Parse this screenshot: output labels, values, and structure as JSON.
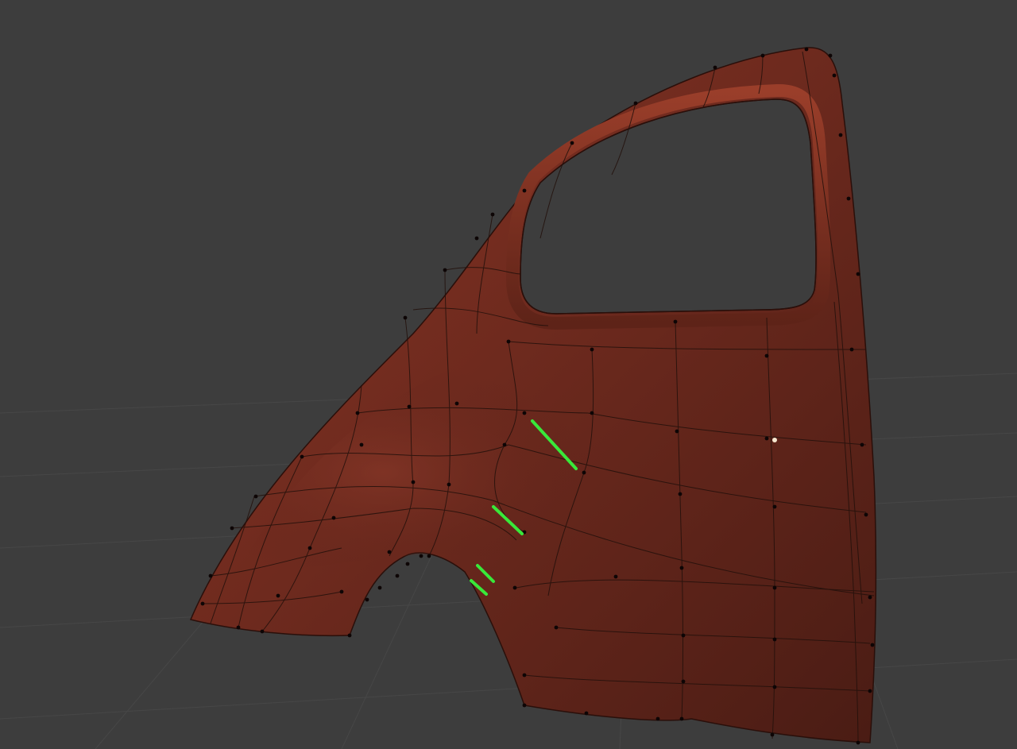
{
  "viewport": {
    "background_color": "#3d3d3d",
    "grid_color": "#4a4a4a",
    "grid_visible": true
  },
  "model": {
    "object": "car-rear-quarter-panel",
    "surface_color": "#6e2a1e",
    "rim_color": "#8a3423",
    "wire_color": "#1f0b07",
    "vertex_color": "#0d0505",
    "selection_color": "#39e83a",
    "selected_edge_count": 4,
    "cursor_marker_color": "#f5e8d0"
  }
}
